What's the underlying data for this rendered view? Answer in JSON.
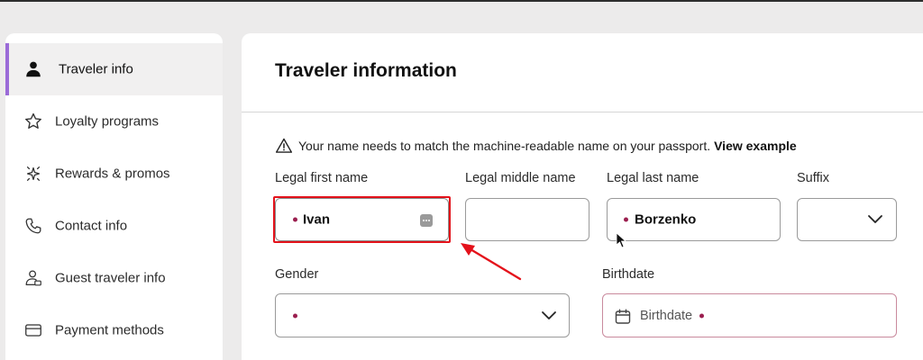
{
  "sidebar": {
    "items": [
      {
        "label": "Traveler info",
        "icon": "person-icon",
        "active": true
      },
      {
        "label": "Loyalty programs",
        "icon": "star-icon",
        "active": false
      },
      {
        "label": "Rewards & promos",
        "icon": "sparkle-icon",
        "active": false
      },
      {
        "label": "Contact info",
        "icon": "phone-icon",
        "active": false
      },
      {
        "label": "Guest traveler info",
        "icon": "guest-traveler-icon",
        "active": false
      },
      {
        "label": "Payment methods",
        "icon": "credit-card-icon",
        "active": false
      }
    ]
  },
  "main": {
    "title": "Traveler information",
    "notice": {
      "text": "Your name needs to match the machine-readable name on your passport.",
      "link": "View example",
      "icon": "warning-icon"
    },
    "fields": {
      "first_name": {
        "label": "Legal first name",
        "value": "Ivan"
      },
      "middle_name": {
        "label": "Legal middle name",
        "value": ""
      },
      "last_name": {
        "label": "Legal last name",
        "value": "Borzenko"
      },
      "suffix": {
        "label": "Suffix",
        "value": ""
      },
      "gender": {
        "label": "Gender",
        "value": ""
      },
      "birthdate": {
        "label": "Birthdate",
        "placeholder": "Birthdate"
      }
    }
  },
  "colors": {
    "accent": "#9b6bd8",
    "required_dot": "#9b1f4f",
    "annotation": "#e4121b",
    "birthdate_border": "#c98a9d"
  }
}
